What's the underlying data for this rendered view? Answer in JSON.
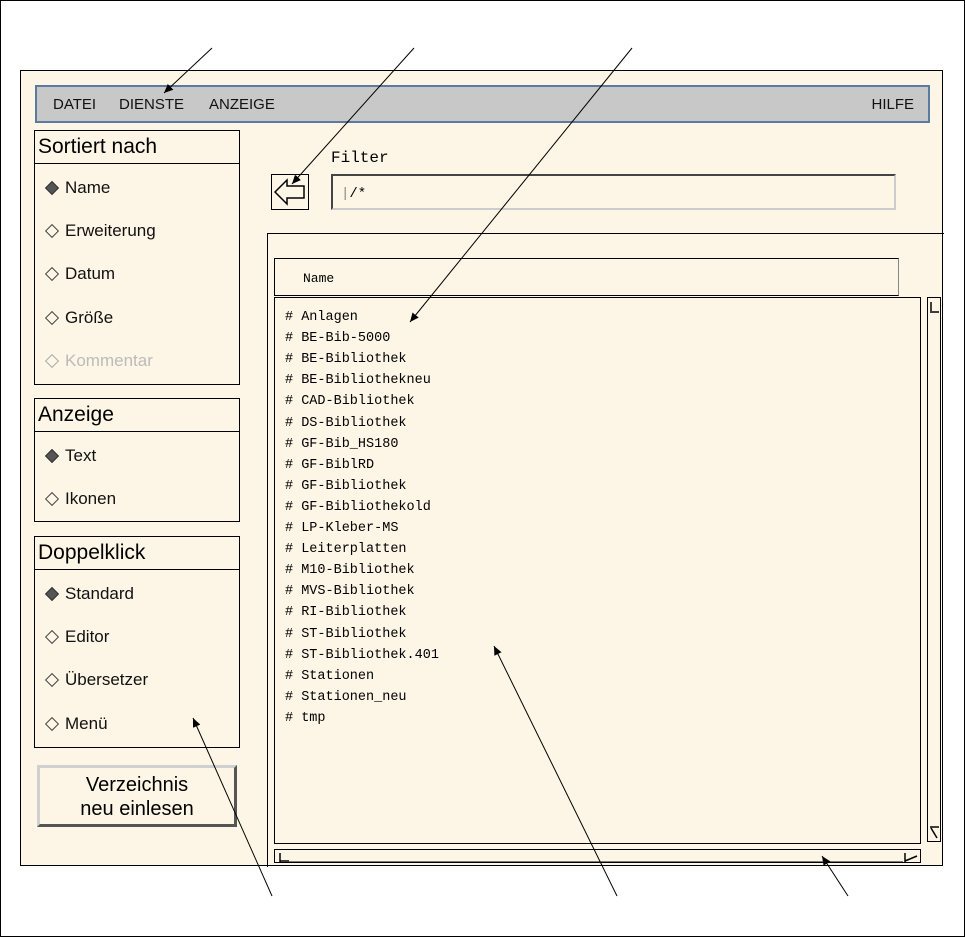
{
  "menubar": {
    "items": [
      "DATEI",
      "DIENSTE",
      "ANZEIGE"
    ],
    "help": "HILFE"
  },
  "sort": {
    "title": "Sortiert nach",
    "options": [
      "Name",
      "Erweiterung",
      "Datum",
      "Größe",
      "Kommentar"
    ]
  },
  "display": {
    "title": "Anzeige",
    "options": [
      "Text",
      "Ikonen"
    ]
  },
  "doubleclick": {
    "title": "Doppelklick",
    "options": [
      "Standard",
      "Editor",
      "Übersetzer",
      "Menü"
    ]
  },
  "reload": {
    "line1": "Verzeichnis",
    "line2": "neu einlesen"
  },
  "filter": {
    "label": "Filter",
    "value": "/*"
  },
  "list": {
    "header": "Name",
    "items": [
      "# Anlagen",
      "# BE-Bib-5000",
      "# BE-Bibliothek",
      "# BE-Bibliothekneu",
      "# CAD-Bibliothek",
      "# DS-Bibliothek",
      "# GF-Bib_HS180",
      "# GF-BiblRD",
      "# GF-Bibliothek",
      "# GF-Bibliothekold",
      "# LP-Kleber-MS",
      "# Leiterplatten",
      "# M10-Bibliothek",
      "# MVS-Bibliothek",
      "# RI-Bibliothek",
      "# ST-Bibliothek",
      "# ST-Bibliothek.401",
      "# Stationen",
      "# Stationen_neu",
      "# tmp"
    ]
  }
}
